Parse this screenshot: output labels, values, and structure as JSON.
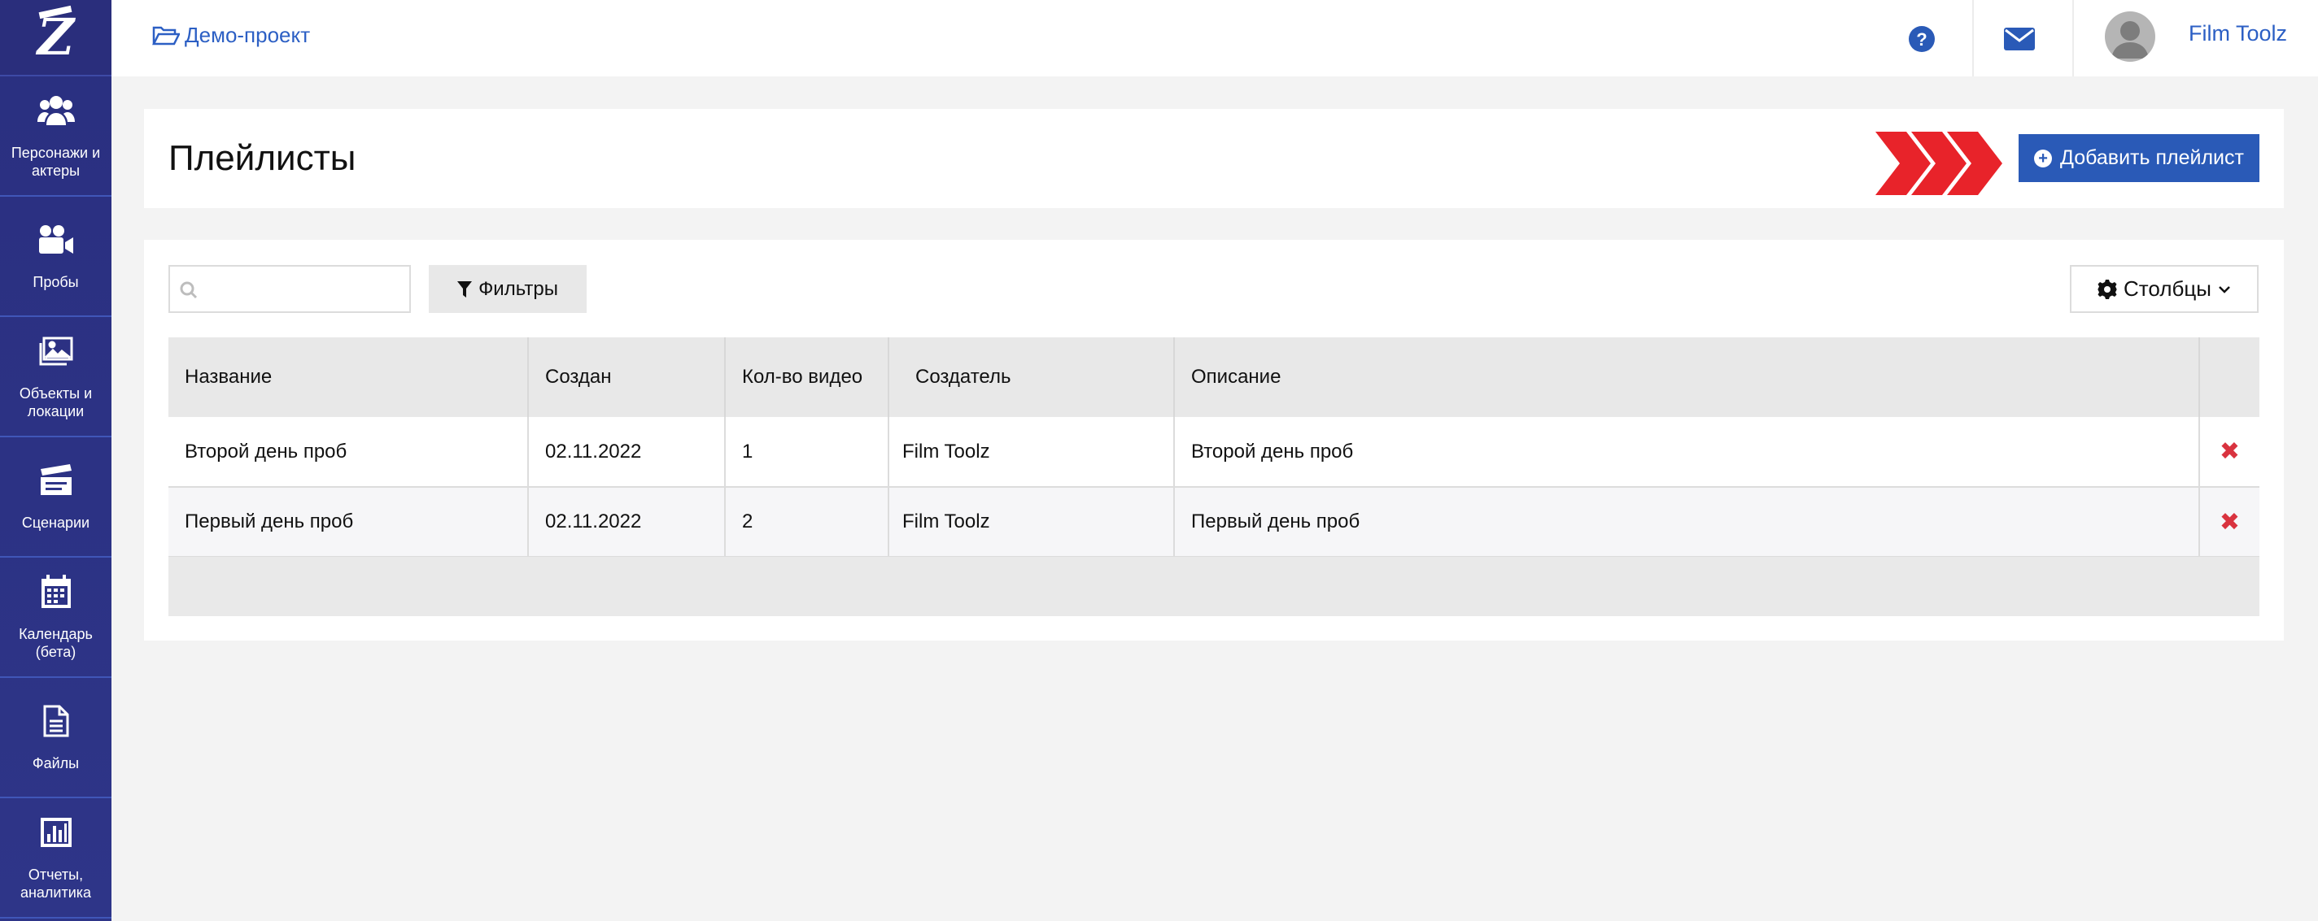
{
  "sidebar": {
    "items": [
      {
        "label": "Персонажи и актеры",
        "icon": "users-icon"
      },
      {
        "label": "Пробы",
        "icon": "video-camera-icon"
      },
      {
        "label": "Объекты и локации",
        "icon": "image-icon"
      },
      {
        "label": "Сценарии",
        "icon": "clapperboard-icon"
      },
      {
        "label": "Календарь (бета)",
        "icon": "calendar-icon"
      },
      {
        "label": "Файлы",
        "icon": "file-icon"
      },
      {
        "label": "Отчеты, аналитика",
        "icon": "bar-chart-icon"
      }
    ]
  },
  "topbar": {
    "project_name": "Демо-проект",
    "project_icon": "folder-open-icon",
    "help_icon": "question-circle-icon",
    "mail_icon": "envelope-icon",
    "username": "Film Toolz"
  },
  "header": {
    "title": "Плейлисты",
    "add_button_label": "Добавить плейлист"
  },
  "toolbar": {
    "search_placeholder": "",
    "filters_label": "Фильтры",
    "columns_label": "Столбцы"
  },
  "table": {
    "columns": [
      "Название",
      "Создан",
      "Кол-во видео",
      "Создатель",
      "Описание"
    ],
    "rows": [
      {
        "name": "Второй день проб",
        "created": "02.11.2022",
        "video_count": "1",
        "creator": "Film Toolz",
        "description": "Второй день проб"
      },
      {
        "name": "Первый день проб",
        "created": "02.11.2022",
        "video_count": "2",
        "creator": "Film Toolz",
        "description": "Первый день проб"
      }
    ]
  },
  "colors": {
    "sidebar_bg": "#2a2f80",
    "accent_blue": "#2a5ab7",
    "link_blue": "#2c5fc4",
    "delete_red": "#d9333f",
    "arrow_red": "#e8232a"
  }
}
